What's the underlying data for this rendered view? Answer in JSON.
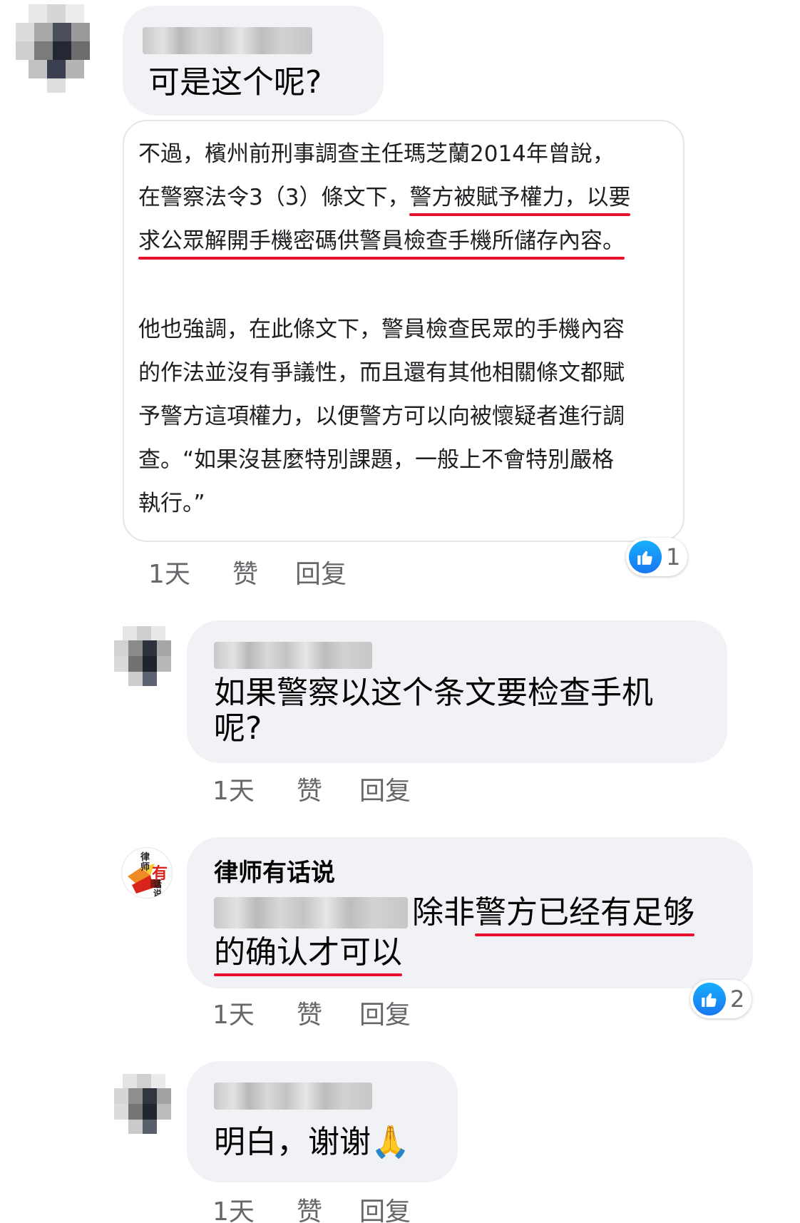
{
  "comments": [
    {
      "author": "",
      "text": "可是这个呢?",
      "time": "1天",
      "like_label": "赞",
      "reply_label": "回复",
      "reactions": "1",
      "quote": {
        "lines": [
          [
            "不過，檳州前刑事調查主任瑪芝蘭2014年曾說，"
          ],
          [
            "在警察法令3（3）條文下，",
            "警方被賦予權力，以要"
          ],
          [
            "求公眾解開手機密碼供警員檢查手機所儲存內容。"
          ],
          [
            "他也強調，在此條文下，警員檢查民眾的手機內容"
          ],
          [
            "的作法並沒有爭議性，而且還有其他相關條文都賦"
          ],
          [
            "予警方這項權力，以便警方可以向被懷疑者進行調"
          ],
          [
            "查。“如果沒甚麼特別課題，一般上不會特別嚴格"
          ],
          [
            "執行。”"
          ]
        ]
      }
    },
    {
      "author": "",
      "text_line1": "如果警察以这个条文要检查手机",
      "text_line2": "呢?",
      "time": "1天",
      "like_label": "赞",
      "reply_label": "回复"
    },
    {
      "author": "律师有话说",
      "text_part1": "除非",
      "text_part2": "警方已经有足够",
      "text_line2": "的确认才可以",
      "time": "1天",
      "like_label": "赞",
      "reply_label": "回复",
      "reactions": "2",
      "logo_text": [
        "律",
        "师",
        "有",
        "话",
        "说"
      ]
    },
    {
      "author": "",
      "text": "明白，谢谢",
      "emoji": "🙏",
      "time": "1天",
      "like_label": "赞",
      "reply_label": "回复"
    }
  ],
  "colors": {
    "bubble": "#f0f2f5",
    "underline": "#e8112d",
    "like_blue": "#1877f2",
    "meta_gray": "#65676b"
  },
  "icons": [
    "thumbs-up-icon",
    "praying-hands-emoji"
  ]
}
